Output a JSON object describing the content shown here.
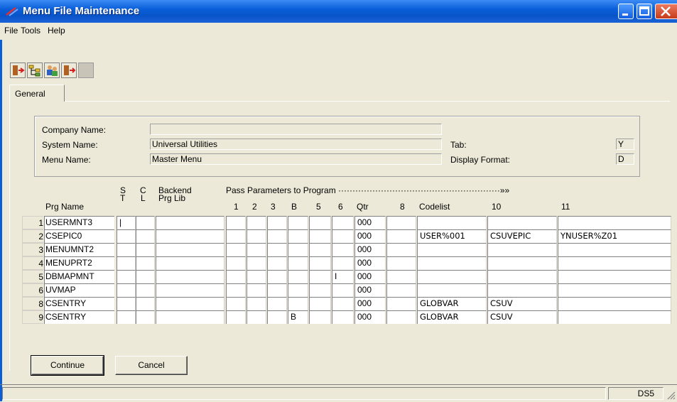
{
  "window": {
    "title": "Menu File Maintenance"
  },
  "menu": [
    "File",
    "Tools",
    "Help"
  ],
  "toolbar_icons": [
    "exit-door-icon",
    "tree-icon",
    "users-icon",
    "door-arrow-icon",
    "blank-icon"
  ],
  "tabs": [
    {
      "label": "General"
    }
  ],
  "info": {
    "company_label": "Company Name:",
    "company_value": "",
    "system_label": "System Name:",
    "system_value": "Universal Utilities",
    "menu_label": "Menu Name:",
    "menu_value": "Master Menu",
    "tab_label": "Tab:",
    "tab_value": "Y",
    "display_label": "Display Format:",
    "display_value": "D"
  },
  "grid": {
    "pass_params_header": "Pass Parameters to Program ·························································»»",
    "headers": {
      "prg_name": "Prg Name",
      "s": "S",
      "t": "T",
      "c": "C",
      "l": "L",
      "backend": "Backend",
      "prg_lib": "Prg Lib",
      "p1": "1",
      "p2": "2",
      "p3": "3",
      "pB": "B",
      "p5": "5",
      "p6": "6",
      "qtr": "Qtr",
      "p8": "8",
      "codelist": "Codelist",
      "p10": "10",
      "p11": "11"
    },
    "rows": [
      {
        "num": "1",
        "name": "USERMNT3",
        "st": "|",
        "cl": "",
        "lib": "",
        "p1": "",
        "p2": "",
        "p3": "",
        "pB": "",
        "p5": "",
        "p6": "",
        "qtr": "000",
        "p8": "",
        "codelist": "",
        "p10": "",
        "p11": ""
      },
      {
        "num": "2",
        "name": "CSEPIC0",
        "st": "",
        "cl": "",
        "lib": "",
        "p1": "",
        "p2": "",
        "p3": "",
        "pB": "",
        "p5": "",
        "p6": "",
        "qtr": "000",
        "p8": "",
        "codelist": "USER%001",
        "p10": "CSUVEPIC",
        "p11": "YNUSER%Z01"
      },
      {
        "num": "3",
        "name": "MENUMNT2",
        "st": "",
        "cl": "",
        "lib": "",
        "p1": "",
        "p2": "",
        "p3": "",
        "pB": "",
        "p5": "",
        "p6": "",
        "qtr": "000",
        "p8": "",
        "codelist": "",
        "p10": "",
        "p11": ""
      },
      {
        "num": "4",
        "name": "MENUPRT2",
        "st": "",
        "cl": "",
        "lib": "",
        "p1": "",
        "p2": "",
        "p3": "",
        "pB": "",
        "p5": "",
        "p6": "",
        "qtr": "000",
        "p8": "",
        "codelist": "",
        "p10": "",
        "p11": ""
      },
      {
        "num": "5",
        "name": "DBMAPMNT",
        "st": "",
        "cl": "",
        "lib": "",
        "p1": "",
        "p2": "",
        "p3": "",
        "pB": "",
        "p5": "",
        "p6": "I",
        "qtr": "000",
        "p8": "",
        "codelist": "",
        "p10": "",
        "p11": ""
      },
      {
        "num": "6",
        "name": "UVMAP",
        "st": "",
        "cl": "",
        "lib": "",
        "p1": "",
        "p2": "",
        "p3": "",
        "pB": "",
        "p5": "",
        "p6": "",
        "qtr": "000",
        "p8": "",
        "codelist": "",
        "p10": "",
        "p11": ""
      },
      {
        "num": "8",
        "name": "CSENTRY",
        "st": "",
        "cl": "",
        "lib": "",
        "p1": "",
        "p2": "",
        "p3": "",
        "pB": "",
        "p5": "",
        "p6": "",
        "qtr": "000",
        "p8": "",
        "codelist": "GLOBVAR",
        "p10": "CSUV",
        "p11": ""
      },
      {
        "num": "9",
        "name": "CSENTRY",
        "st": "",
        "cl": "",
        "lib": "",
        "p1": "",
        "p2": "",
        "p3": "",
        "pB": "B",
        "p5": "",
        "p6": "",
        "qtr": "000",
        "p8": "",
        "codelist": "GLOBVAR",
        "p10": "CSUV",
        "p11": ""
      }
    ]
  },
  "buttons": {
    "continue": "Continue",
    "cancel": "Cancel"
  },
  "status": {
    "pane2": "DS5"
  }
}
